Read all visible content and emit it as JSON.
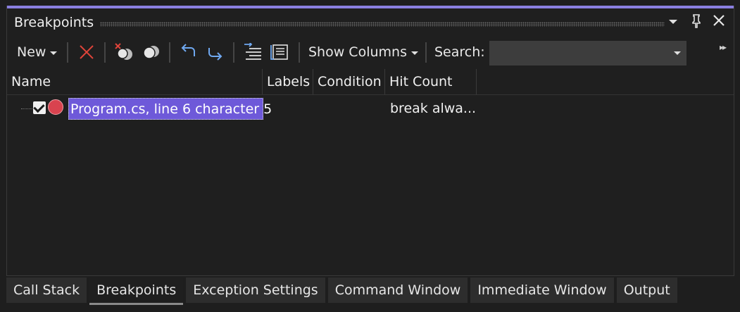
{
  "window": {
    "title": "Breakpoints"
  },
  "title_icons": {
    "dropdown": "▾",
    "pin": "pin-icon",
    "close": "✕"
  },
  "toolbar": {
    "new_label": "New",
    "show_columns_label": "Show Columns",
    "search_label": "Search:",
    "search_value": ""
  },
  "columns": {
    "name": "Name",
    "labels": "Labels",
    "condition": "Condition",
    "hit_count": "Hit Count"
  },
  "breakpoints": [
    {
      "name": "Program.cs, line 6 character 5",
      "labels": "",
      "condition": "",
      "hit_count": "break alwa...",
      "enabled": true
    }
  ],
  "tabs": [
    {
      "label": "Call Stack"
    },
    {
      "label": "Breakpoints",
      "active": true
    },
    {
      "label": "Exception Settings"
    },
    {
      "label": "Command Window"
    },
    {
      "label": "Immediate Window"
    },
    {
      "label": "Output"
    }
  ],
  "colors": {
    "accent": "#8a7fe0",
    "selection": "#6e59d9",
    "breakpoint": "#d9434f",
    "delete": "#e0443a",
    "arrows": "#6fa8f0"
  }
}
